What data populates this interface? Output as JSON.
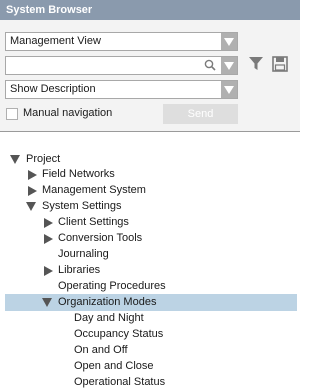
{
  "title": "System Browser",
  "controls": {
    "view_select": "Management View",
    "search_value": "",
    "description_select": "Show Description",
    "manual_navigation_label": "Manual navigation",
    "manual_navigation_checked": false,
    "send_label": "Send"
  },
  "tree": {
    "project": "Project",
    "field_networks": "Field Networks",
    "management_system": "Management System",
    "system_settings": "System Settings",
    "client_settings": "Client Settings",
    "conversion_tools": "Conversion Tools",
    "journaling": "Journaling",
    "libraries": "Libraries",
    "operating_procedures": "Operating Procedures",
    "organization_modes": "Organization Modes",
    "day_and_night": "Day and Night",
    "occupancy_status": "Occupancy Status",
    "on_and_off": "On and Off",
    "open_and_close": "Open and Close",
    "operational_status": "Operational Status"
  },
  "colors": {
    "title_bar": "#8a9aad",
    "selection": "#bcd3e4",
    "disabled_button": "#dedede"
  }
}
